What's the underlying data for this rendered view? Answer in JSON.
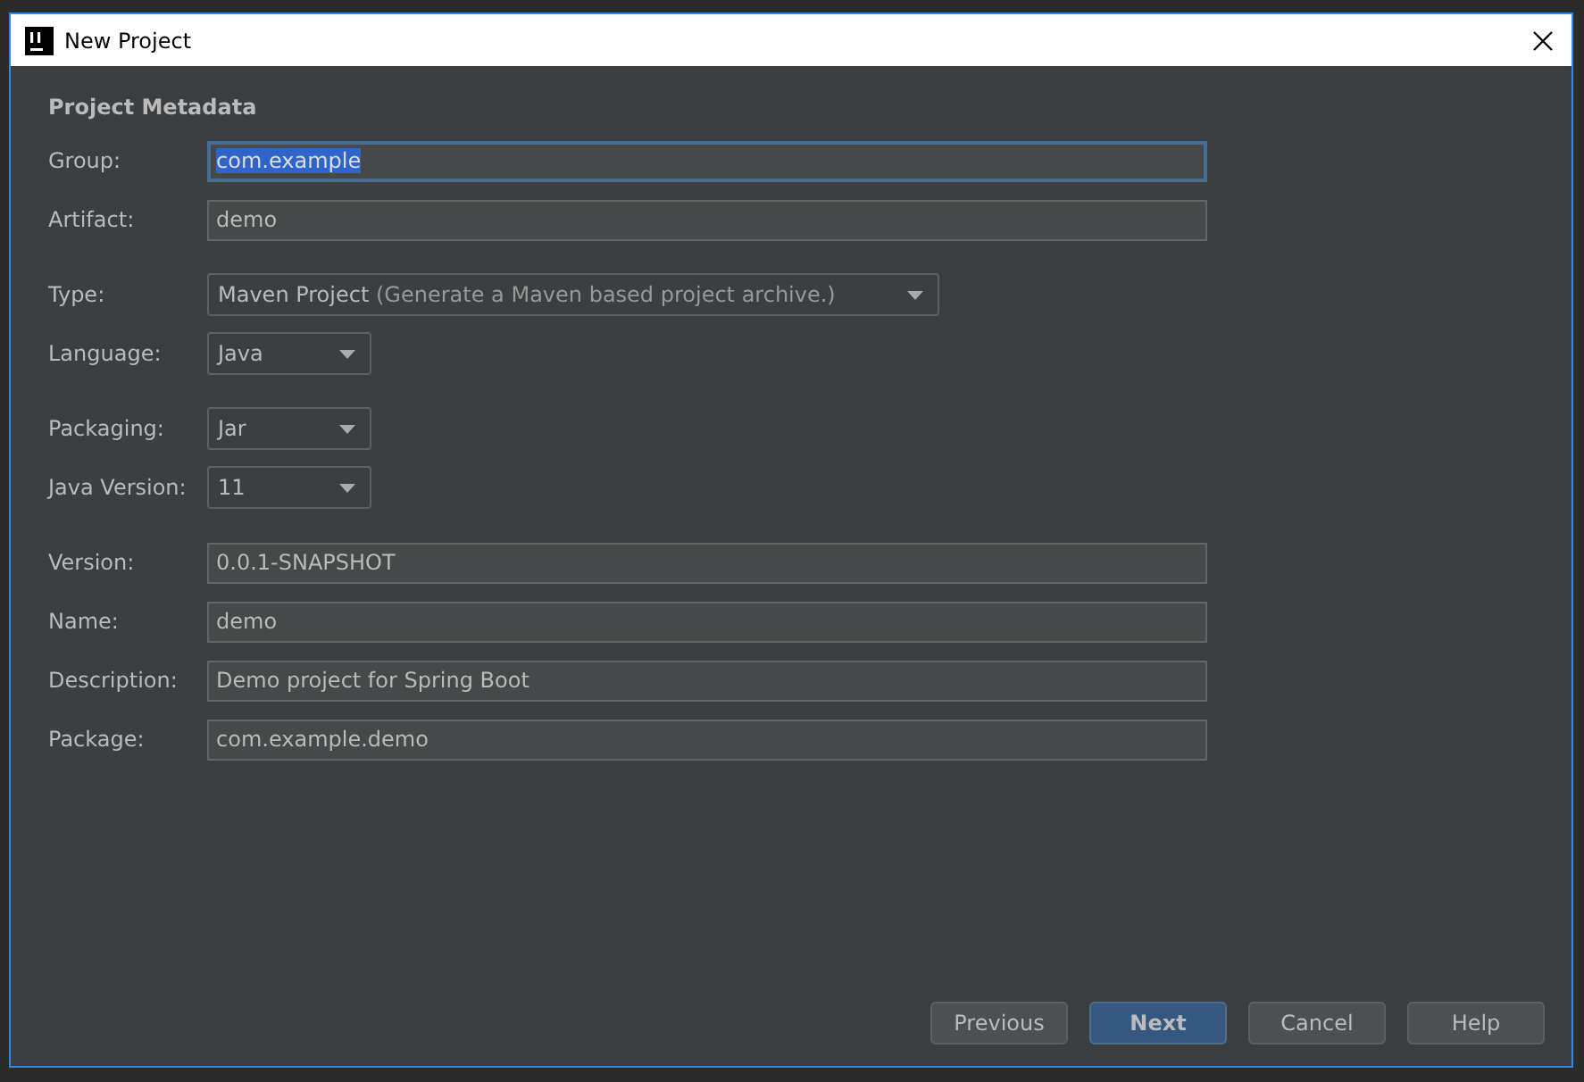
{
  "window": {
    "title": "New Project"
  },
  "section_title": "Project Metadata",
  "groups": [
    [
      {
        "kind": "text",
        "label": "Group:",
        "value": "com.example",
        "focused": true,
        "text_selected": true
      },
      {
        "kind": "text",
        "label": "Artifact:",
        "value": "demo",
        "focused": false,
        "text_selected": false
      }
    ],
    [
      {
        "kind": "combo",
        "label": "Type:",
        "value": "Maven Project",
        "hint": "(Generate a Maven based project archive.)"
      },
      {
        "kind": "combo",
        "label": "Language:",
        "value": "Java"
      }
    ],
    [
      {
        "kind": "combo",
        "label": "Packaging:",
        "value": "Jar"
      },
      {
        "kind": "combo",
        "label": "Java Version:",
        "value": "11"
      }
    ],
    [
      {
        "kind": "text",
        "label": "Version:",
        "value": "0.0.1-SNAPSHOT",
        "focused": false,
        "text_selected": false
      },
      {
        "kind": "text",
        "label": "Name:",
        "value": "demo",
        "focused": false,
        "text_selected": false
      },
      {
        "kind": "text",
        "label": "Description:",
        "value": "Demo project for Spring Boot",
        "focused": false,
        "text_selected": false
      },
      {
        "kind": "text",
        "label": "Package:",
        "value": "com.example.demo",
        "focused": false,
        "text_selected": false
      }
    ]
  ],
  "buttons": [
    {
      "label": "Previous",
      "default": false
    },
    {
      "label": "Next",
      "default": true
    },
    {
      "label": "Cancel",
      "default": false
    },
    {
      "label": "Help",
      "default": false
    }
  ]
}
